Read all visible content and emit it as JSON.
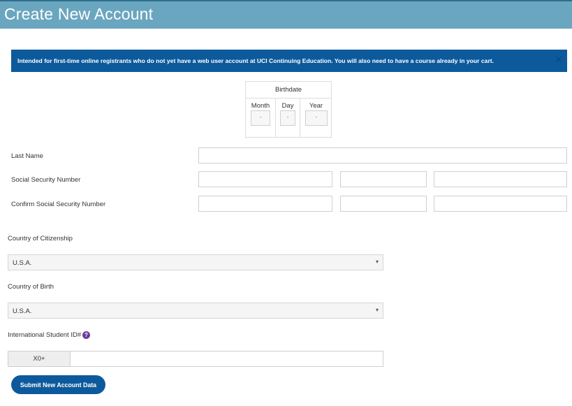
{
  "header": {
    "title": "Create New Account"
  },
  "alert": {
    "message": "Intended for first-time online registrants who do not yet have a web user account at UCI Continuing Education. You will also need to have a course already in your cart.",
    "close_glyph": "✕"
  },
  "birthdate": {
    "title": "Birthdate",
    "month_label": "Month",
    "day_label": "Day",
    "year_label": "Year",
    "month_value": "-",
    "day_value": "-",
    "year_value": "-"
  },
  "fields": {
    "last_name_label": "Last Name",
    "ssn_label": "Social Security Number",
    "confirm_ssn_label": "Confirm Social Security Number",
    "last_name_value": "",
    "ssn_part1": "",
    "ssn_part2": "",
    "ssn_part3": "",
    "confirm_ssn_part1": "",
    "confirm_ssn_part2": "",
    "confirm_ssn_part3": ""
  },
  "citizenship": {
    "label": "Country of Citizenship",
    "value": "U.S.A."
  },
  "birth_country": {
    "label": "Country of Birth",
    "value": "U.S.A."
  },
  "intl_id": {
    "label": "International Student ID#",
    "help_glyph": "?",
    "prefix": "X0+",
    "value": ""
  },
  "submit": {
    "label": "Submit New Account Data"
  },
  "colors": {
    "header": "#6aa6bf",
    "alert": "#0c5a9c",
    "button": "#0c5a9c",
    "help_icon": "#6a3d9a"
  },
  "icons": {
    "alert_close": "close-icon",
    "help": "question-circle-icon",
    "select_caret": "caret-icon"
  }
}
